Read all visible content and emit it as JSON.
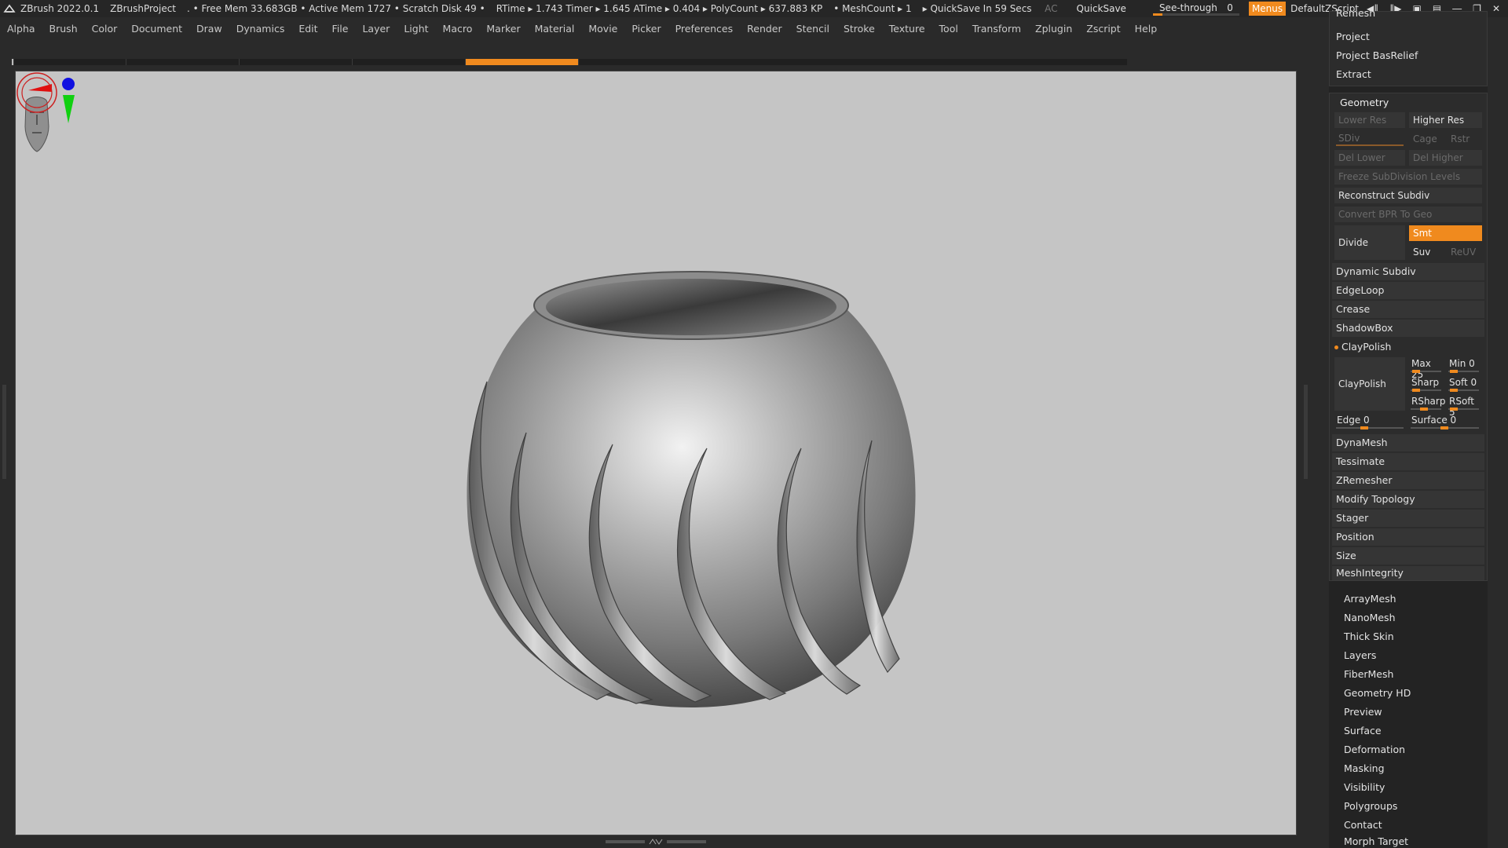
{
  "titlebar": {
    "app": "ZBrush 2022.0.1",
    "project": "ZBrushProject",
    "status": ". • Free Mem 33.683GB • Active Mem 1727 • Scratch Disk 49 •",
    "stats": "RTime ▸ 1.743 Timer ▸ 1.645 ATime ▸ 0.404 ▸ PolyCount ▸ 637.883 KP",
    "meshcount": "• MeshCount ▸ 1",
    "quicksave_status": "▸ QuickSave In 59 Secs",
    "ac": "AC",
    "quicksave": "QuickSave",
    "seethrough_label": "See-through",
    "seethrough_value": "0",
    "menus": "Menus",
    "defaultzscript": "DefaultZScript"
  },
  "menubar": [
    "Alpha",
    "Brush",
    "Color",
    "Document",
    "Draw",
    "Dynamics",
    "Edit",
    "File",
    "Layer",
    "Light",
    "Macro",
    "Marker",
    "Material",
    "Movie",
    "Picker",
    "Preferences",
    "Render",
    "Stencil",
    "Stroke",
    "Texture",
    "Tool",
    "Transform",
    "Zplugin",
    "Zscript",
    "Help"
  ],
  "palette": {
    "top": {
      "remesh": "Remesh",
      "project": "Project",
      "project_basrelief": "Project BasRelief",
      "extract": "Extract"
    },
    "geometry": {
      "header": "Geometry",
      "lower_res": "Lower Res",
      "higher_res": "Higher Res",
      "sdiv": "SDiv",
      "cage": "Cage",
      "rstr": "Rstr",
      "del_lower": "Del Lower",
      "del_higher": "Del Higher",
      "freeze": "Freeze SubDivision Levels",
      "reconstruct": "Reconstruct Subdiv",
      "convert_bpr": "Convert BPR To Geo",
      "divide": "Divide",
      "smt": "Smt",
      "suv": "Suv",
      "reuv": "ReUV",
      "dynamic_subdiv": "Dynamic Subdiv",
      "edgeloop": "EdgeLoop",
      "crease": "Crease",
      "shadowbox": "ShadowBox",
      "claypolish_header": "ClayPolish",
      "claypolish_btn": "ClayPolish",
      "max": "Max 25",
      "min": "Min 0",
      "sharp": "Sharp",
      "soft": "Soft 0",
      "rsharp": "RSharp",
      "rsoft": "RSoft 5",
      "edge": "Edge 0",
      "surface": "Surface 0",
      "dynamesh": "DynaMesh",
      "tessimate": "Tessimate",
      "zremesher": "ZRemesher",
      "modify_topology": "Modify Topology",
      "stager": "Stager",
      "position": "Position",
      "size": "Size",
      "meshintegrity": "MeshIntegrity"
    },
    "subpalettes": [
      "ArrayMesh",
      "NanoMesh",
      "Thick Skin",
      "Layers",
      "FiberMesh",
      "Geometry HD",
      "Preview",
      "Surface",
      "Deformation",
      "Masking",
      "Visibility",
      "Polygroups",
      "Contact",
      "Morph Target"
    ]
  },
  "icons": {
    "logo": "zbrush-logo-icon",
    "brush_cursor": "brush-cursor-icon",
    "navcube": "navigation-head-icon"
  },
  "colors": {
    "accent": "#f08a1e",
    "viewport_bg": "#c5c5c5",
    "panel_bg": "#2c2c2c"
  }
}
